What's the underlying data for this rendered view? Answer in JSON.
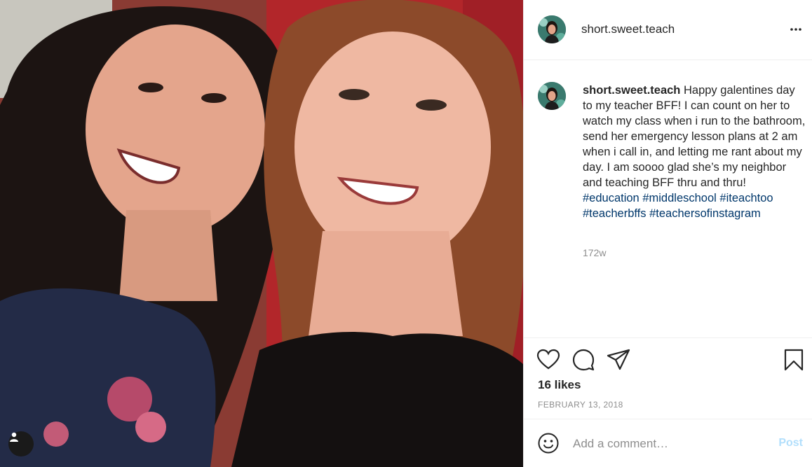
{
  "post": {
    "username": "short.sweet.teach",
    "caption_user": "short.sweet.teach",
    "caption_text": "Happy galentines day to my teacher BFF! I can count on her to watch my class when i run to the bathroom, send her emergency lesson plans at 2 am when i call in, and letting me rant about my day. I am soooo glad she’s my neighbor and teaching BFF thru and thru!",
    "hashtags": [
      "#education",
      "#middleschool",
      "#iteachtoo",
      "#teacherbffs",
      "#teachersofinstagram"
    ],
    "age": "172w",
    "likes": "16 likes",
    "date": "FEBRUARY 13, 2018"
  },
  "comment": {
    "placeholder": "Add a comment…",
    "post_label": "Post"
  },
  "icons": {
    "like": "heart-icon",
    "comment": "comment-icon",
    "share": "paper-plane-icon",
    "save": "bookmark-icon",
    "more": "more-horizontal-icon",
    "emoji": "smiley-icon",
    "tagged": "user-icon"
  },
  "colors": {
    "hashtag": "#00376b",
    "text": "#262626",
    "muted": "#8e8e8e",
    "post_disabled": "#b2dffc",
    "divider": "#efefef"
  }
}
